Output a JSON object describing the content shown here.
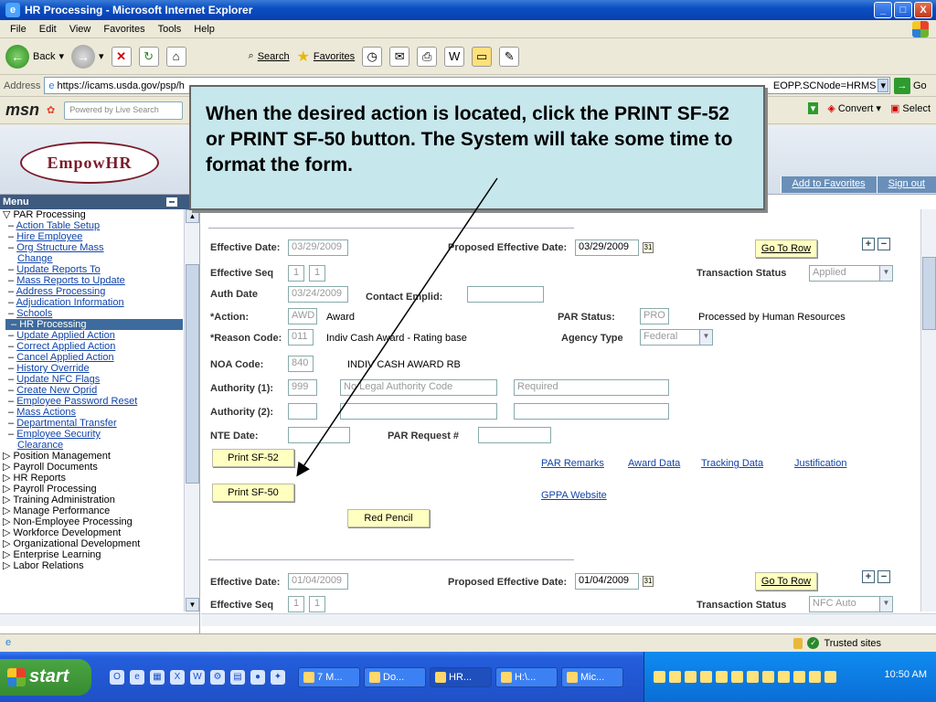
{
  "window": {
    "title": "HR Processing - Microsoft Internet Explorer",
    "controls": [
      "_",
      "□",
      "X"
    ]
  },
  "menubar": [
    "File",
    "Edit",
    "View",
    "Favorites",
    "Tools",
    "Help"
  ],
  "toolbar": {
    "back": "Back",
    "search": "Search",
    "favorites": "Favorites"
  },
  "address": {
    "label": "Address",
    "url": "https://icams.usda.gov/psp/h",
    "url_tail": "EOPP.SCNode=HRMS",
    "go": "Go"
  },
  "msn": {
    "logo": "msn",
    "search_placeholder": "Powered by Live Search",
    "convert": "Convert",
    "select": "Select"
  },
  "header": {
    "logo_text": "EmpowHR",
    "add_favorites": "Add to Favorites",
    "sign_out": "Sign out"
  },
  "sidebar": {
    "title": "Menu",
    "section": "PAR Processing",
    "items": [
      "Action Table Setup",
      "Hire Employee",
      "Org Structure Mass",
      "Change",
      "Update Reports To",
      "Mass Reports to Update",
      "Address Processing",
      "Adjudication Information",
      "Schools",
      "HR Processing",
      "Update Applied Action",
      "Correct Applied Action",
      "Cancel Applied Action",
      "History Override",
      "Update NFC Flags",
      "Create New Oprid",
      "Employee Password Reset",
      "Mass Actions",
      "Departmental Transfer",
      "Employee Security",
      "Clearance"
    ],
    "top_items": [
      "Position Management",
      "Payroll Documents",
      "HR Reports",
      "Payroll Processing",
      "Training Administration",
      "Manage Performance",
      "Non-Employee Processing",
      "Workforce Development",
      "Organizational Development",
      "Enterprise Learning",
      "Labor Relations"
    ]
  },
  "record1": {
    "effective_date_label": "Effective Date:",
    "effective_date": "03/29/2009",
    "proposed_label": "Proposed Effective Date:",
    "proposed": "03/29/2009",
    "go_to_row": "Go To Row",
    "effective_seq_label": "Effective Seq",
    "seq1": "1",
    "seq2": "1",
    "transaction_status_label": "Transaction Status",
    "transaction_status": "Applied",
    "auth_date_label": "Auth Date",
    "auth_date": "03/24/2009",
    "contact_emplid_label": "Contact Emplid:",
    "action_label": "*Action:",
    "action_code": "AWD",
    "action_desc": "Award",
    "par_status_label": "PAR Status:",
    "par_status_code": "PRO",
    "par_status_desc": "Processed by Human Resources",
    "reason_label": "*Reason Code:",
    "reason_code": "011",
    "reason_desc": "Indiv Cash Award - Rating base",
    "agency_type_label": "Agency Type",
    "agency_type": "Federal",
    "noa_label": "NOA Code:",
    "noa_code": "840",
    "noa_desc": "INDIV CASH AWARD RB",
    "authority1_label": "Authority (1):",
    "authority1_code": "999",
    "authority1_desc": "No Legal Authority Code",
    "authority1_extra": "Required",
    "authority2_label": "Authority (2):",
    "nte_label": "NTE Date:",
    "par_request_label": "PAR Request #",
    "print_sf52": "Print SF-52",
    "print_sf50": "Print SF-50",
    "red_pencil": "Red Pencil",
    "links": [
      "PAR Remarks",
      "Award Data",
      "Tracking Data",
      "Justification"
    ],
    "gppa": "GPPA Website"
  },
  "record2": {
    "effective_date_label": "Effective Date:",
    "effective_date": "01/04/2009",
    "proposed_label": "Proposed Effective Date:",
    "proposed": "01/04/2009",
    "go_to_row": "Go To Row",
    "effective_seq_label": "Effective Seq",
    "seq1": "1",
    "seq2": "1",
    "transaction_status_label": "Transaction Status",
    "transaction_status": "NFC Auto"
  },
  "callout": {
    "text": "When the desired action is located, click the PRINT SF-52 or PRINT SF-50 button. The System will take some time to format the form."
  },
  "statusbar": {
    "zone": "Trusted sites"
  },
  "taskbar": {
    "start": "start",
    "tasks": [
      "7 M...",
      "Do...",
      "HR...",
      "H:\\...",
      "Mic..."
    ],
    "clock": "10:50 AM"
  }
}
